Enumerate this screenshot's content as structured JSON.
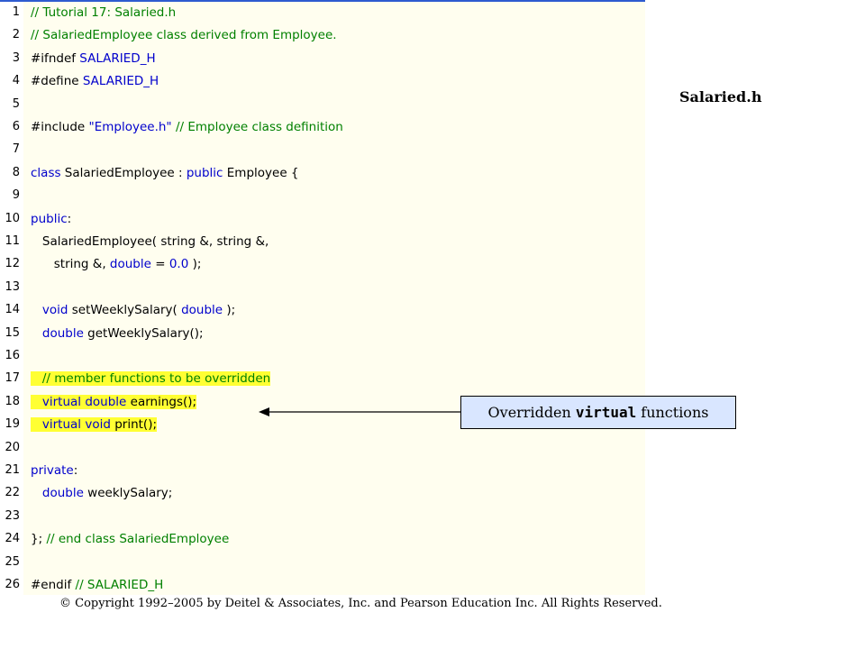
{
  "file_title": "Salaried.h",
  "callout": {
    "prefix": "Overridden",
    "keyword": "virtual",
    "suffix": "functions"
  },
  "copyright": "© Copyright 1992–2005 by Deitel & Associates, Inc. and Pearson Education Inc. All Rights Reserved.",
  "colors": {
    "keyword": "#0000cc",
    "comment": "#008000",
    "highlight": "#ffff33",
    "code_background": "#fffeef",
    "callout_background": "#d9e6ff"
  },
  "code_lines": [
    {
      "num": "1",
      "highlight": false,
      "tokens": [
        {
          "t": "cm",
          "v": "// Tutorial 17: Salaried.h"
        }
      ]
    },
    {
      "num": "2",
      "highlight": false,
      "tokens": [
        {
          "t": "cm",
          "v": "// SalariedEmployee class derived from Employee."
        }
      ]
    },
    {
      "num": "3",
      "highlight": false,
      "tokens": [
        {
          "t": "pl",
          "v": "#ifndef "
        },
        {
          "t": "kw",
          "v": "SALARIED_H"
        }
      ]
    },
    {
      "num": "4",
      "highlight": false,
      "tokens": [
        {
          "t": "pl",
          "v": "#define "
        },
        {
          "t": "kw",
          "v": "SALARIED_H"
        }
      ]
    },
    {
      "num": "5",
      "highlight": false,
      "tokens": []
    },
    {
      "num": "6",
      "highlight": false,
      "tokens": [
        {
          "t": "pl",
          "v": "#include "
        },
        {
          "t": "str",
          "v": "\"Employee.h\""
        },
        {
          "t": "pl",
          "v": " "
        },
        {
          "t": "cm",
          "v": "// Employee class definition"
        }
      ]
    },
    {
      "num": "7",
      "highlight": false,
      "tokens": []
    },
    {
      "num": "8",
      "highlight": false,
      "tokens": [
        {
          "t": "kw",
          "v": "class"
        },
        {
          "t": "pl",
          "v": " SalariedEmployee : "
        },
        {
          "t": "kw",
          "v": "public"
        },
        {
          "t": "pl",
          "v": " Employee {"
        }
      ]
    },
    {
      "num": "9",
      "highlight": false,
      "tokens": []
    },
    {
      "num": "10",
      "highlight": false,
      "tokens": [
        {
          "t": "kw",
          "v": "public"
        },
        {
          "t": "pl",
          "v": ":"
        }
      ]
    },
    {
      "num": "11",
      "highlight": false,
      "tokens": [
        {
          "t": "pl",
          "v": "   SalariedEmployee( string &, string &,"
        }
      ]
    },
    {
      "num": "12",
      "highlight": false,
      "tokens": [
        {
          "t": "pl",
          "v": "      string &, "
        },
        {
          "t": "kw",
          "v": "double"
        },
        {
          "t": "pl",
          "v": " = "
        },
        {
          "t": "kw",
          "v": "0.0"
        },
        {
          "t": "pl",
          "v": " );"
        }
      ]
    },
    {
      "num": "13",
      "highlight": false,
      "tokens": []
    },
    {
      "num": "14",
      "highlight": false,
      "tokens": [
        {
          "t": "pl",
          "v": "   "
        },
        {
          "t": "kw",
          "v": "void"
        },
        {
          "t": "pl",
          "v": " setWeeklySalary( "
        },
        {
          "t": "kw",
          "v": "double"
        },
        {
          "t": "pl",
          "v": " );"
        }
      ]
    },
    {
      "num": "15",
      "highlight": false,
      "tokens": [
        {
          "t": "pl",
          "v": "   "
        },
        {
          "t": "kw",
          "v": "double"
        },
        {
          "t": "pl",
          "v": " getWeeklySalary();"
        }
      ]
    },
    {
      "num": "16",
      "highlight": false,
      "tokens": []
    },
    {
      "num": "17",
      "highlight": true,
      "tokens": [
        {
          "t": "pl",
          "v": "   "
        },
        {
          "t": "cm",
          "v": "// member functions to be overridden"
        }
      ]
    },
    {
      "num": "18",
      "highlight": true,
      "tokens": [
        {
          "t": "pl",
          "v": "   "
        },
        {
          "t": "kw",
          "v": "virtual"
        },
        {
          "t": "pl",
          "v": " "
        },
        {
          "t": "kw",
          "v": "double"
        },
        {
          "t": "pl",
          "v": " earnings();"
        }
      ]
    },
    {
      "num": "19",
      "highlight": true,
      "tokens": [
        {
          "t": "pl",
          "v": "   "
        },
        {
          "t": "kw",
          "v": "virtual"
        },
        {
          "t": "pl",
          "v": " "
        },
        {
          "t": "kw",
          "v": "void"
        },
        {
          "t": "pl",
          "v": " print();"
        }
      ]
    },
    {
      "num": "20",
      "highlight": false,
      "tokens": []
    },
    {
      "num": "21",
      "highlight": false,
      "tokens": [
        {
          "t": "kw",
          "v": "private"
        },
        {
          "t": "pl",
          "v": ":"
        }
      ]
    },
    {
      "num": "22",
      "highlight": false,
      "tokens": [
        {
          "t": "pl",
          "v": "   "
        },
        {
          "t": "kw",
          "v": "double"
        },
        {
          "t": "pl",
          "v": " weeklySalary;"
        }
      ]
    },
    {
      "num": "23",
      "highlight": false,
      "tokens": []
    },
    {
      "num": "24",
      "highlight": false,
      "tokens": [
        {
          "t": "pl",
          "v": "}; "
        },
        {
          "t": "cm",
          "v": "// end class SalariedEmployee"
        }
      ]
    },
    {
      "num": "25",
      "highlight": false,
      "tokens": []
    },
    {
      "num": "26",
      "highlight": false,
      "tokens": [
        {
          "t": "pl",
          "v": "#endif "
        },
        {
          "t": "cm",
          "v": "// SALARIED_H"
        }
      ]
    }
  ]
}
